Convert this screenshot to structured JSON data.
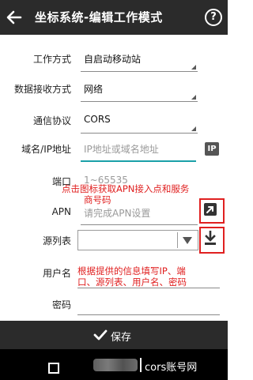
{
  "header": {
    "title": "坐标系统-编辑工作模式",
    "help_label": "?"
  },
  "form": {
    "work_mode": {
      "label": "工作方式",
      "value": "自启动移动站"
    },
    "receive_mode": {
      "label": "数据接收方式",
      "value": "网络"
    },
    "protocol": {
      "label": "通信协议",
      "value": "CORS"
    },
    "domain": {
      "label": "域名/IP地址",
      "placeholder": "IP地址或域名地址",
      "badge": "IP"
    },
    "port": {
      "label": "端口",
      "placeholder": "1~65535"
    },
    "apn": {
      "label": "APN",
      "placeholder": "请完成APN设置"
    },
    "source_table": {
      "label": "源列表",
      "value": ""
    },
    "username": {
      "label": "用户名",
      "value": ""
    },
    "password": {
      "label": "密码",
      "value": ""
    }
  },
  "annotations": {
    "apn_note_line1": "点击图标获取APN接入点和服务",
    "apn_note_line2": "商号码",
    "fill_note_line1": "根据提供的信息填写IP、端",
    "fill_note_line2": "口、源列表、用户名、密码"
  },
  "footer": {
    "save_label": "保存"
  },
  "watermark": {
    "text": "cors账号网"
  },
  "colors": {
    "bar": "#2b2b2b",
    "accent": "#1aa0a8",
    "annotation": "#e02020"
  }
}
